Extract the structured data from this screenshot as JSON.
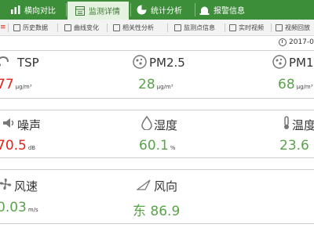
{
  "topnav": {
    "tabs": [
      {
        "label": "横向对比",
        "icon": "bar-chart-icon"
      },
      {
        "label": "监测详情",
        "icon": "details-icon",
        "active": true
      },
      {
        "label": "统计分析",
        "icon": "pie-chart-icon"
      },
      {
        "label": "报警信息",
        "icon": "alarm-icon"
      }
    ]
  },
  "subnav": {
    "items": [
      {
        "label": "历史数据"
      },
      {
        "label": "曲线变化"
      },
      {
        "label": "相关性分析"
      },
      {
        "label": "监测点信息"
      },
      {
        "label": "实时视频"
      },
      {
        "label": "视频回放"
      }
    ]
  },
  "date": "2017-0",
  "metrics": [
    {
      "label": "TSP",
      "value": "77",
      "unit": "μg/m³",
      "color": "#e2231a",
      "icon": "dust-icon"
    },
    {
      "label": "PM2.5",
      "value": "28",
      "unit": "μg/m³",
      "color": "#5aa34a",
      "icon": "particle-icon"
    },
    {
      "label": "PM1",
      "value": "68",
      "unit": "μg/m³",
      "color": "#5aa34a",
      "icon": "particle-icon"
    },
    {
      "label": "噪声",
      "value": "70.5",
      "unit": "dB",
      "color": "#e2231a",
      "icon": "noise-icon"
    },
    {
      "label": "湿度",
      "value": "60.1",
      "unit": "%",
      "color": "#5aa34a",
      "icon": "humidity-icon"
    },
    {
      "label": "温度",
      "value": "23.6",
      "unit": "",
      "color": "#5aa34a",
      "icon": "thermometer-icon"
    },
    {
      "label": "风速",
      "value": "0.03",
      "unit": "m/s",
      "color": "#5aa34a",
      "icon": "fan-icon"
    },
    {
      "label": "风向",
      "value": "东 86.9",
      "unit": "",
      "color": "#5aa34a",
      "icon": "wind-direction-icon"
    }
  ]
}
